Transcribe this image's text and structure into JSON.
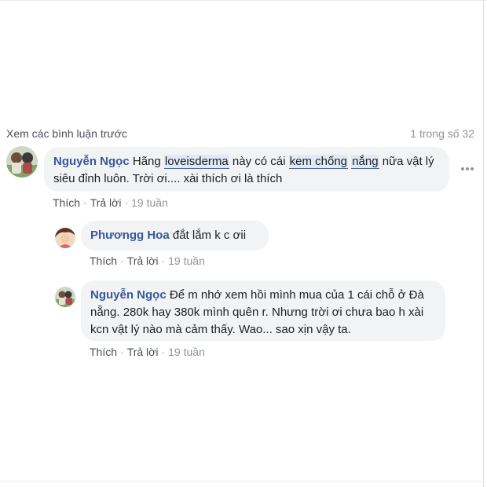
{
  "header": {
    "view_previous": "Xem các bình luận trước",
    "count": "1 trong số 32"
  },
  "comments": [
    {
      "author": "Nguyễn Ngọc",
      "text_parts": [
        "Hãng ",
        "loveisderma",
        " này có cái ",
        "kem chống",
        " ",
        "nắng",
        " nữa vật lý siêu đỉnh luôn. Trời ơi.... xài thích ơi là thích"
      ],
      "like": "Thích",
      "reply": "Trả lời",
      "time": "19 tuần"
    },
    {
      "author": "Phươngg Hoa",
      "text": "đắt lắm k c ơii",
      "like": "Thích",
      "reply": "Trả lời",
      "time": "19 tuần"
    },
    {
      "author": "Nguyễn Ngọc",
      "text": "Để m nhớ xem hồi mình mua của 1 cái chỗ ở Đà nẵng. 280k hay 380k mình quên r. Nhưng trời ơi chưa bao h xài kcn vật lý nào mà cảm thấy. Wao... sao xịn vậy ta.",
      "like": "Thích",
      "reply": "Trả lời",
      "time": "19 tuần"
    }
  ],
  "colors": {
    "author": "#385898",
    "bubble": "#f2f3f5",
    "tag_bg": "#e1e9f7"
  }
}
